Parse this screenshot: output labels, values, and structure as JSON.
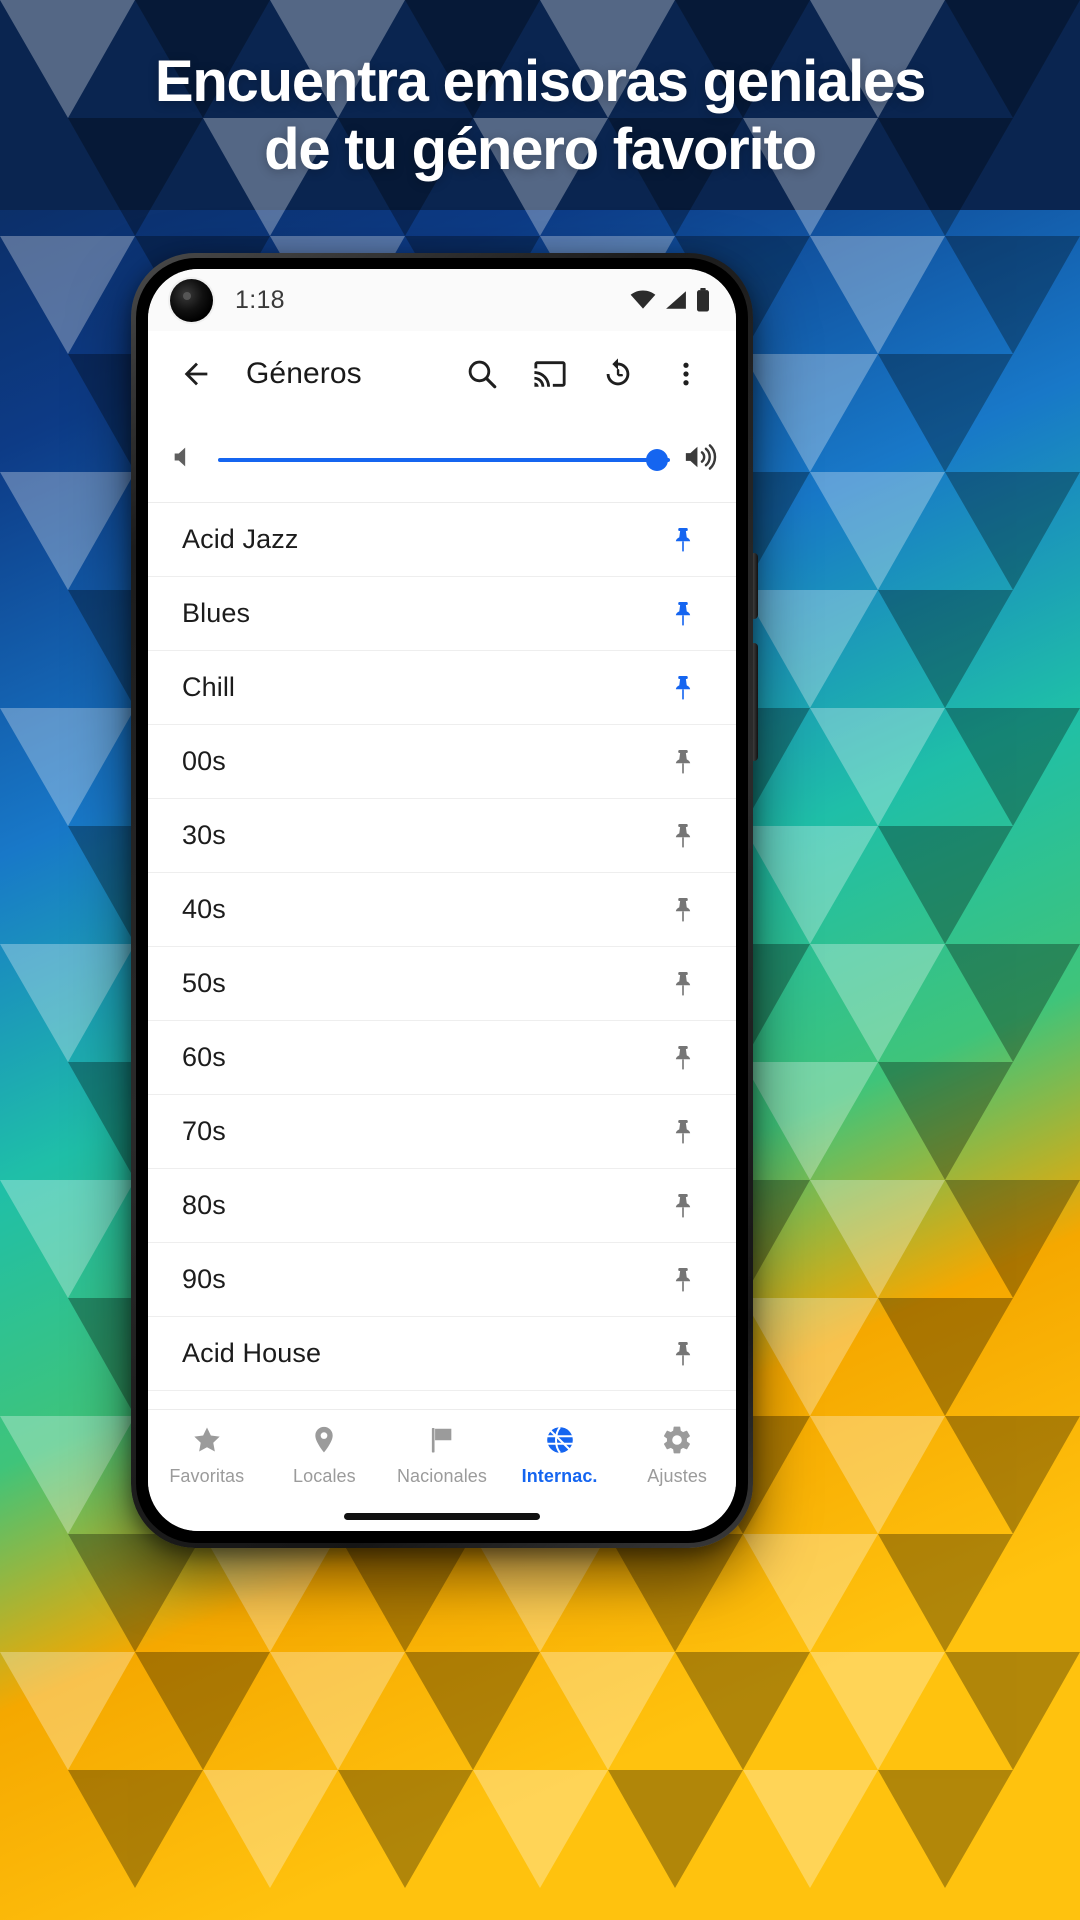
{
  "headline": {
    "line1": "Encuentra emisoras geniales",
    "line2": "de tu género favorito"
  },
  "colors": {
    "accent": "#1565f0",
    "pin_active": "#1565f0",
    "pin_inactive": "#757575",
    "nav_inactive": "#9b9b9b",
    "headline_text": "#ffffff",
    "bg_dark_blue": "#0a2a5e",
    "screen_bg": "#ffffff"
  },
  "phone": {
    "statusbar": {
      "time": "1:18",
      "icons": [
        "wifi-icon",
        "cellular-signal-icon",
        "battery-icon"
      ]
    },
    "appbar": {
      "back_icon": "back-arrow-icon",
      "title": "Géneros",
      "actions": [
        {
          "icon": "search-icon",
          "label": "Buscar"
        },
        {
          "icon": "cast-icon",
          "label": "Transmitir"
        },
        {
          "icon": "sleep-timer-icon",
          "label": "Temporizador"
        },
        {
          "icon": "overflow-menu-icon",
          "label": "Más opciones"
        }
      ]
    },
    "volume": {
      "mute_icon": "volume-mute-icon",
      "max_icon": "volume-up-icon",
      "value": 100
    },
    "genres": [
      {
        "label": "Acid Jazz",
        "pinned": true
      },
      {
        "label": "Blues",
        "pinned": true
      },
      {
        "label": "Chill",
        "pinned": true
      },
      {
        "label": "00s",
        "pinned": false
      },
      {
        "label": "30s",
        "pinned": false
      },
      {
        "label": "40s",
        "pinned": false
      },
      {
        "label": "50s",
        "pinned": false
      },
      {
        "label": "60s",
        "pinned": false
      },
      {
        "label": "70s",
        "pinned": false
      },
      {
        "label": "80s",
        "pinned": false
      },
      {
        "label": "90s",
        "pinned": false
      },
      {
        "label": "Acid House",
        "pinned": false
      }
    ],
    "bottomnav": [
      {
        "label": "Favoritas",
        "icon": "star-icon",
        "active": false
      },
      {
        "label": "Locales",
        "icon": "location-pin-icon",
        "active": false
      },
      {
        "label": "Nacionales",
        "icon": "flag-icon",
        "active": false
      },
      {
        "label": "Internac.",
        "icon": "globe-icon",
        "active": true
      },
      {
        "label": "Ajustes",
        "icon": "gear-icon",
        "active": false
      }
    ]
  }
}
